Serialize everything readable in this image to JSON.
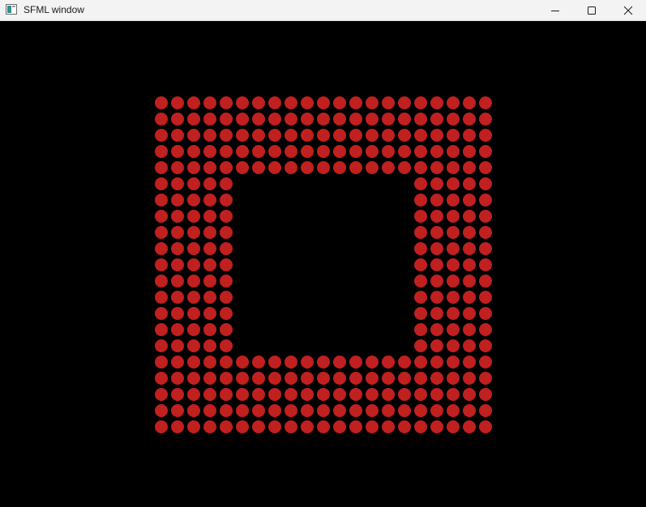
{
  "window": {
    "title": "SFML window"
  },
  "titlebar": {
    "buttons": [
      {
        "name": "minimize",
        "icon": "minimize-icon"
      },
      {
        "name": "maximize",
        "icon": "maximize-icon"
      },
      {
        "name": "close",
        "icon": "close-icon"
      }
    ]
  },
  "scene": {
    "background_color": "#000000",
    "dot_color": "#c0201f",
    "grid_columns": 21,
    "grid_rows": 21,
    "hole_columns": [
      5,
      15
    ],
    "hole_rows": [
      5,
      15
    ]
  }
}
